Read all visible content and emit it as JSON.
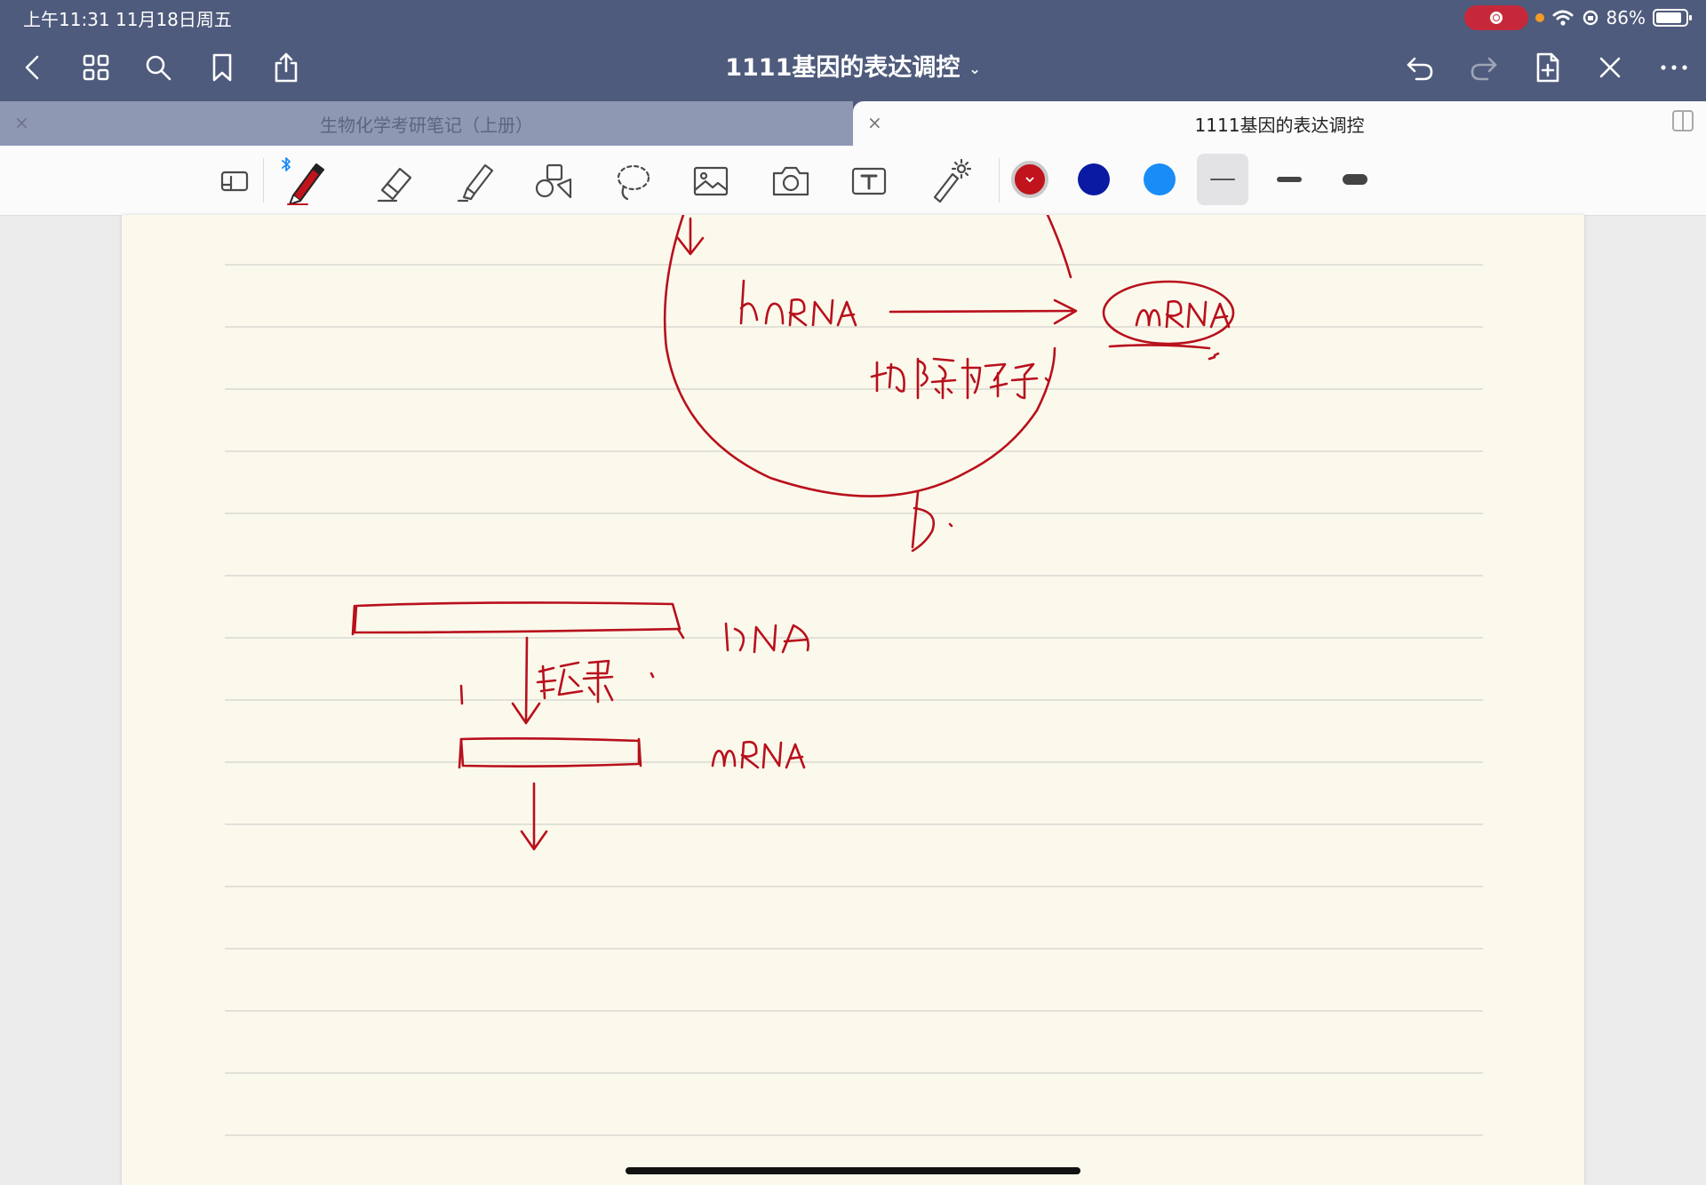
{
  "status_bar": {
    "time": "上午11:31   11月18日周五",
    "battery": "86%",
    "battery_level": 0.86
  },
  "nav": {
    "title": "1111基因的表达调控",
    "title_chevron": "⌄"
  },
  "tabs": [
    {
      "label": "生物化学考研笔记（上册）",
      "close": "×",
      "active": false
    },
    {
      "label": "1111基因的表达调控",
      "close": "×",
      "active": true
    }
  ],
  "toolbar": {
    "tools": [
      "pen",
      "eraser",
      "highlighter",
      "shapes",
      "lasso",
      "image",
      "camera",
      "text",
      "laser-pointer"
    ],
    "selected_tool": "pen",
    "pen_colors": [
      "#c0131c",
      "#0a1aa3",
      "#1a8cf5"
    ],
    "selected_color": "#c0131c",
    "stroke_sizes": [
      "thin",
      "medium",
      "thick"
    ],
    "selected_size": "thin",
    "accent": "#4f5b7c"
  },
  "ink_color": "#b8101c",
  "page": {
    "background": "#fbf9ec",
    "ruled": true
  }
}
